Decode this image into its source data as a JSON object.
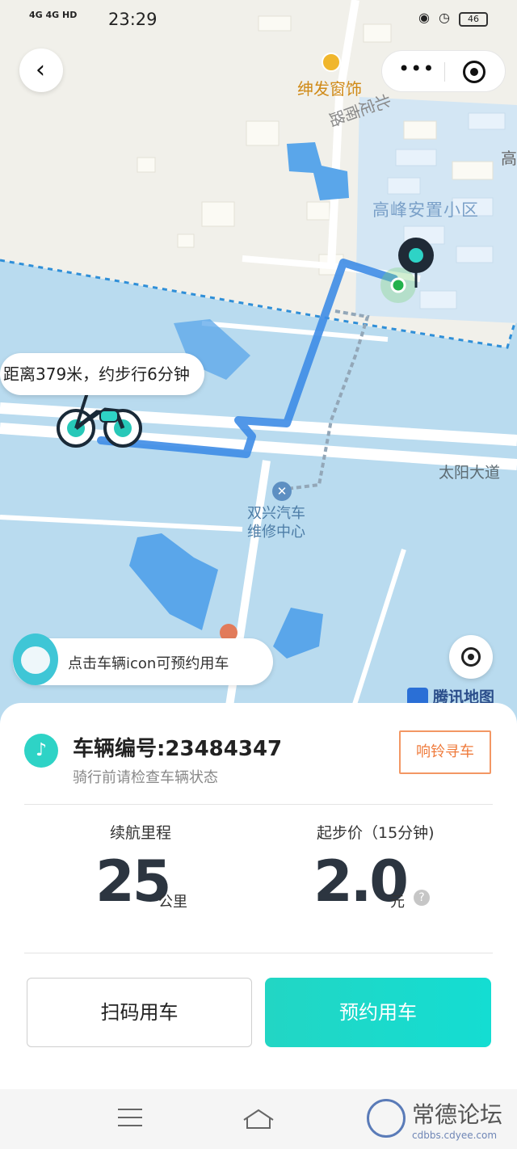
{
  "status_bar": {
    "signal": "4G 4G HD",
    "time": "23:29",
    "battery": "46"
  },
  "map": {
    "shop_label": "绅发窗饰",
    "road_north": "北定南路",
    "edge_label": "高",
    "area_label": "高峰安置小区",
    "road_east": "太阳大道",
    "repair_label_line1": "双兴汽车",
    "repair_label_line2": "维修中心",
    "distance_bubble": "距离379米，约步行6分钟",
    "map_brand": "腾讯地图",
    "colors": {
      "water": "#b9dbef",
      "route": "#4a90e8",
      "lake": "#5aa6ea",
      "land": "#f1f0ea"
    }
  },
  "hint": {
    "text": "点击车辆icon可预约用车"
  },
  "vehicle": {
    "title": "车辆编号:23484347",
    "subtitle": "骑行前请检查车辆状态",
    "ring_button": "响铃寻车"
  },
  "stats": {
    "range_label": "续航里程",
    "range_value": "25",
    "range_unit": "公里",
    "price_label": "起步价（15分钟)",
    "price_value": "2.0",
    "price_unit": "元",
    "help_glyph": "?"
  },
  "actions": {
    "scan_label": "扫码用车",
    "reserve_label": "预约用车"
  },
  "watermark": {
    "text": "常德论坛",
    "sub": "cdbbs.cdyee.com"
  },
  "icons": {
    "back": "‹",
    "more": "•••",
    "bell": "🔔",
    "wrench": "✕"
  },
  "accent_color": "#1ed8c8"
}
